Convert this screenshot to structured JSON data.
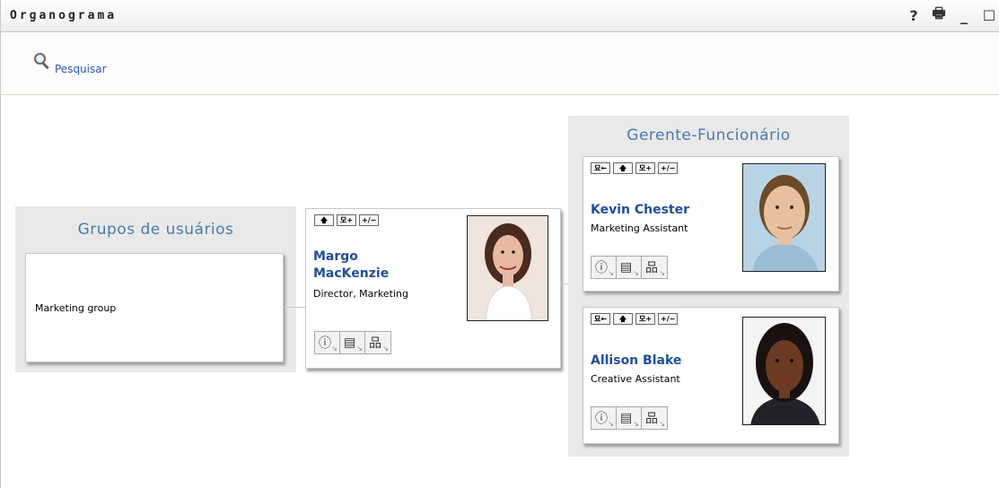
{
  "window": {
    "title": "Organograma",
    "icons": [
      "help-icon",
      "print-icon",
      "minimize-icon",
      "maximize-icon"
    ],
    "help_glyph": "?",
    "print_glyph": "🖶",
    "minimize_glyph": "_",
    "maximize_glyph": "☐"
  },
  "toolbar": {
    "search_label": "Pesquisar"
  },
  "groups_panel": {
    "title": "Grupos de usuários",
    "items": [
      "Marketing group"
    ]
  },
  "manager_panel": {
    "title": "Gerente-Funcionário"
  },
  "buttons": {
    "up": "🡅",
    "expand": "모+",
    "toggle": "+/−",
    "back": "묘←"
  },
  "actions": {
    "info_glyph": "ⓘ",
    "email_glyph": "▤",
    "org_glyph": "品",
    "arrow_glyph": "↘"
  },
  "people": [
    {
      "name_line1": "Margo",
      "name_line2": "MacKenzie",
      "title": "Director, Marketing"
    },
    {
      "name": "Kevin Chester",
      "title": "Marketing Assistant"
    },
    {
      "name": "Allison Blake",
      "title": "Creative Assistant"
    }
  ],
  "colors": {
    "link": "#2a5aa8",
    "name": "#1f4f9a",
    "panel_title": "#4a7ab0",
    "panel_bg": "#e9e9e9"
  }
}
